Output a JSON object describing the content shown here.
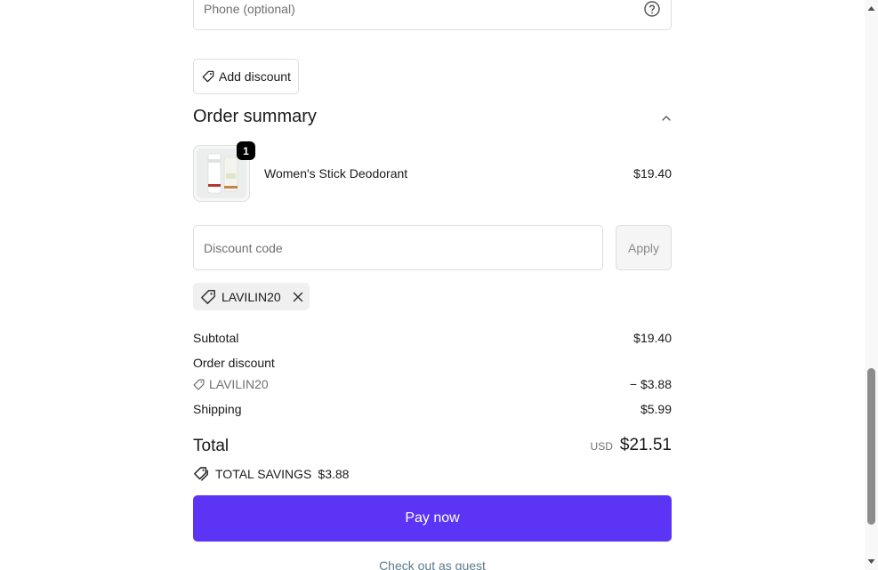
{
  "contact": {
    "phone_placeholder": "Phone (optional)"
  },
  "discount_button": {
    "label": "Add discount"
  },
  "order_summary": {
    "title": "Order summary",
    "items": [
      {
        "name": "Women's Stick Deodorant",
        "price": "$19.40",
        "quantity": "1"
      }
    ],
    "discount_input": {
      "placeholder": "Discount code",
      "value": ""
    },
    "apply_label": "Apply",
    "applied_code": "LAVILIN20",
    "subtotal_label": "Subtotal",
    "subtotal_value": "$19.40",
    "order_discount_label": "Order discount",
    "discount_code_line": "LAVILIN20",
    "discount_value": "− $3.88",
    "shipping_label": "Shipping",
    "shipping_value": "$5.99",
    "total_label": "Total",
    "total_currency": "USD",
    "total_value": "$21.51",
    "savings_label": "TOTAL SAVINGS",
    "savings_value": "$3.88"
  },
  "actions": {
    "pay_label": "Pay now",
    "guest_label": "Check out as guest"
  },
  "colors": {
    "accent": "#5b34f5",
    "badge": "#000000",
    "muted_text": "#707070"
  }
}
